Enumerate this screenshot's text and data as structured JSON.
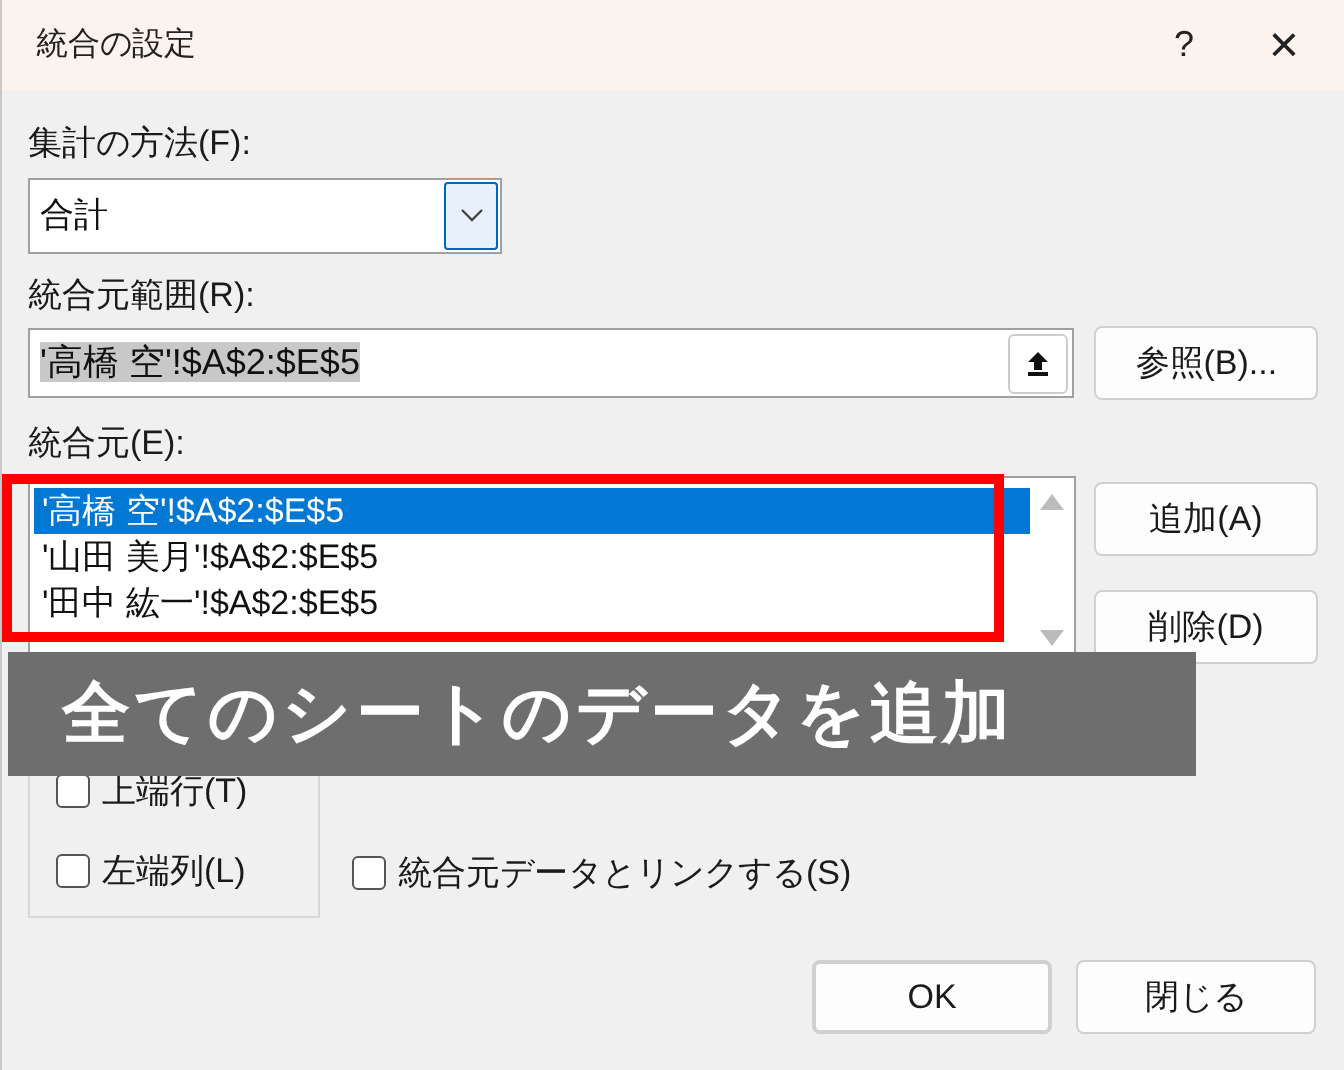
{
  "window": {
    "title": "統合の設定",
    "help": "?",
    "close": "×"
  },
  "function": {
    "label": "集計の方法(F):",
    "value": "合計"
  },
  "reference": {
    "label": "統合元範囲(R):",
    "value": "'高橋 空'!$A$2:$E$5",
    "browse_button": "参照(B)..."
  },
  "sources": {
    "label": "統合元(E):",
    "items": [
      {
        "text": "'高橋 空'!$A$2:$E$5",
        "selected": true
      },
      {
        "text": "'山田 美月'!$A$2:$E$5",
        "selected": false
      },
      {
        "text": "'田中 紘一'!$A$2:$E$5",
        "selected": false
      }
    ],
    "add_button": "追加(A)",
    "delete_button": "削除(D)"
  },
  "labels": [
    {
      "text": "上端行(T)",
      "checked": false
    },
    {
      "text": "左端列(L)",
      "checked": false
    }
  ],
  "link": {
    "text": "統合元データとリンクする(S)",
    "checked": false
  },
  "buttons": [
    "OK",
    "閉じる"
  ],
  "annotation": {
    "text": "全てのシートのデータを追加"
  }
}
